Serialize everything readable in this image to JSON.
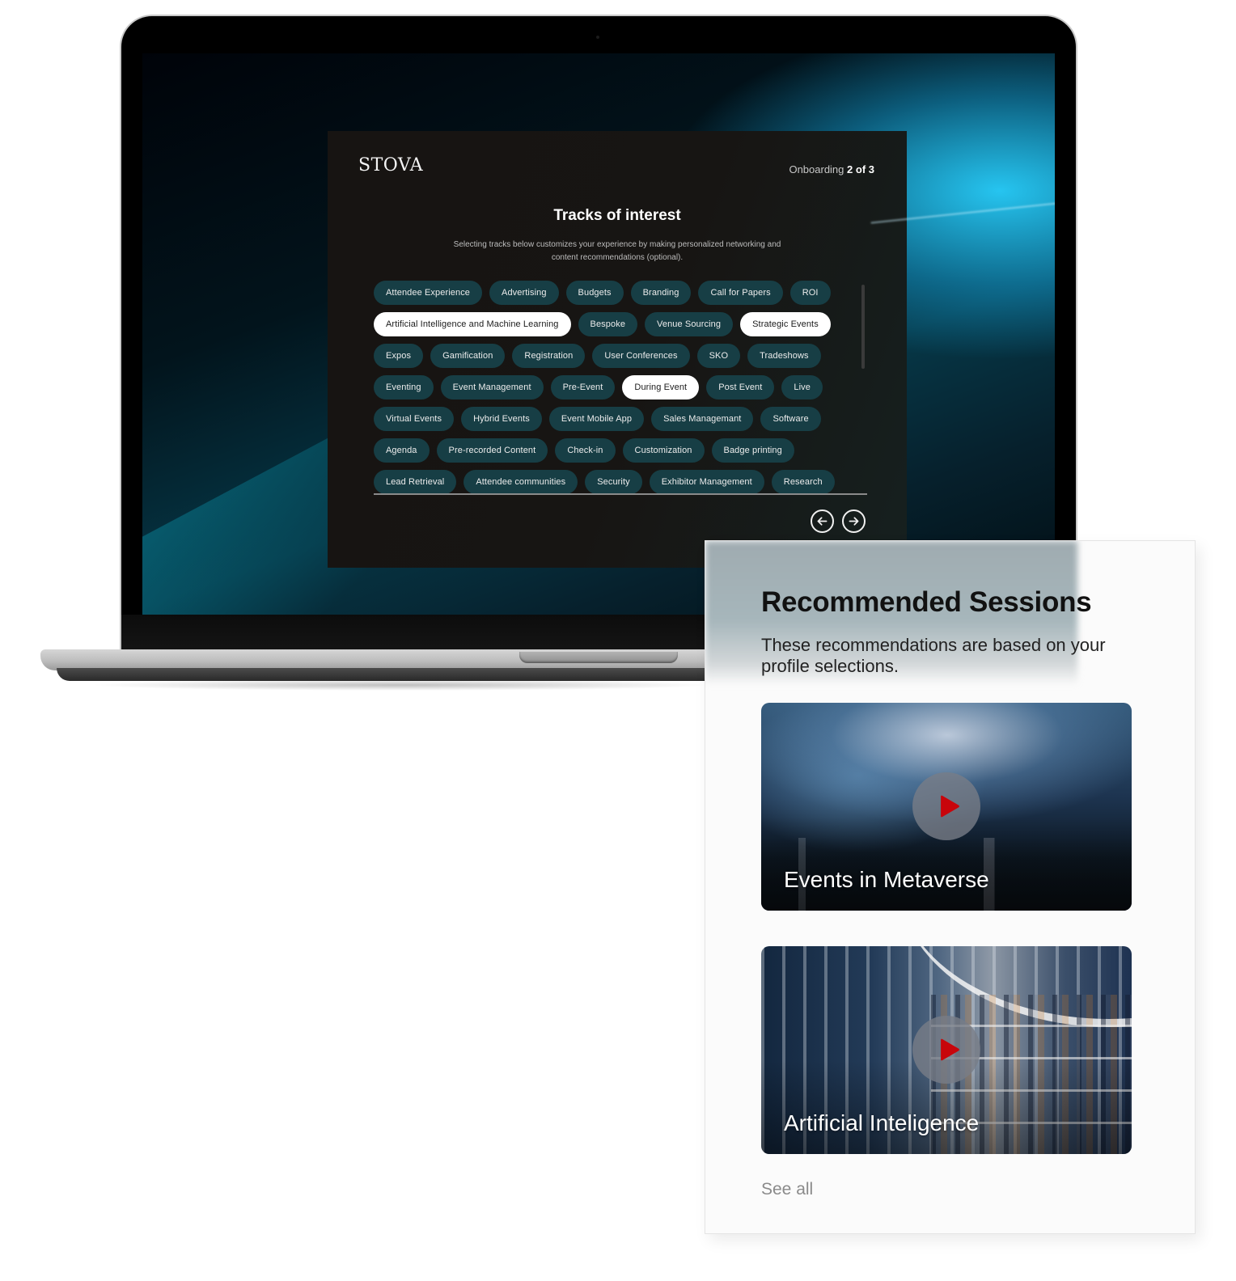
{
  "onboarding": {
    "logo": "STOVA",
    "step_label": "Onboarding",
    "step_value": "2 of 3",
    "title": "Tracks of interest",
    "subtitle": "Selecting tracks below customizes your experience by making personalized networking and content recommendations (optional).",
    "tracks": [
      {
        "label": "Attendee Experience",
        "selected": false
      },
      {
        "label": "Advertising",
        "selected": false
      },
      {
        "label": "Budgets",
        "selected": false
      },
      {
        "label": "Branding",
        "selected": false
      },
      {
        "label": "Call for Papers",
        "selected": false
      },
      {
        "label": "ROI",
        "selected": false
      },
      {
        "label": "Artificial Intelligence and Machine Learning",
        "selected": true
      },
      {
        "label": "Bespoke",
        "selected": false
      },
      {
        "label": "Venue Sourcing",
        "selected": false
      },
      {
        "label": "Strategic Events",
        "selected": true
      },
      {
        "label": "Expos",
        "selected": false
      },
      {
        "label": "Gamification",
        "selected": false
      },
      {
        "label": "Registration",
        "selected": false
      },
      {
        "label": "User Conferences",
        "selected": false
      },
      {
        "label": "SKO",
        "selected": false
      },
      {
        "label": "Tradeshows",
        "selected": false
      },
      {
        "label": "Eventing",
        "selected": false
      },
      {
        "label": "Event Management",
        "selected": false
      },
      {
        "label": "Pre-Event",
        "selected": false
      },
      {
        "label": "During Event",
        "selected": true
      },
      {
        "label": "Post Event",
        "selected": false
      },
      {
        "label": "Live",
        "selected": false
      },
      {
        "label": "Virtual Events",
        "selected": false
      },
      {
        "label": "Hybrid Events",
        "selected": false
      },
      {
        "label": "Event Mobile App",
        "selected": false
      },
      {
        "label": "Sales Managemant",
        "selected": false
      },
      {
        "label": "Software",
        "selected": false
      },
      {
        "label": "Agenda",
        "selected": false
      },
      {
        "label": "Pre-recorded Content",
        "selected": false
      },
      {
        "label": "Check-in",
        "selected": false
      },
      {
        "label": "Customization",
        "selected": false
      },
      {
        "label": "Badge printing",
        "selected": false
      },
      {
        "label": "Lead Retrieval",
        "selected": false
      },
      {
        "label": "Attendee communities",
        "selected": false
      },
      {
        "label": "Security",
        "selected": false
      },
      {
        "label": "Exhibitor Management",
        "selected": false
      },
      {
        "label": "Research",
        "selected": false
      }
    ],
    "nav": {
      "prev_icon": "arrow-left-circle-icon",
      "next_icon": "arrow-right-circle-icon"
    }
  },
  "recommended": {
    "title": "Recommended Sessions",
    "subtitle": "These recommendations are based on your profile selections.",
    "sessions": [
      {
        "title": "Events in Metaverse",
        "icon": "play-icon"
      },
      {
        "title": "Artificial Inteligence",
        "icon": "play-icon"
      }
    ],
    "see_all": "See all"
  },
  "colors": {
    "chip_bg": "#173e45",
    "chip_selected_bg": "#ffffff",
    "panel_bg": "#171412",
    "play_icon": "#c8050b"
  }
}
